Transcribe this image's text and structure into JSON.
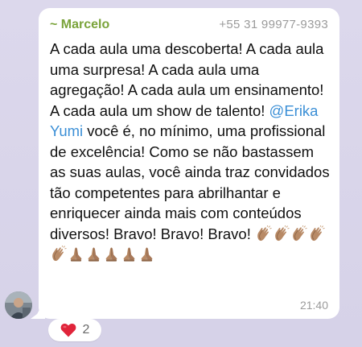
{
  "colors": {
    "chat_background": "#d8d4ea",
    "bubble": "#ffffff",
    "sender_name": "#7aa33a",
    "mention": "#3b8fd6",
    "meta_text": "#9b9b9b"
  },
  "message": {
    "sender_name": "~ Marcelo",
    "sender_phone": "+55 31 99977-9393",
    "text_before_mention": "A cada aula uma descoberta! A cada aula uma surpresa! A cada aula uma agregação! A cada aula um ensinamento! A cada aula um show de talento! ",
    "mention": "@Erika Yumi",
    "text_after_mention": " você é, no mínimo, uma profissional de excelência! Como se não bastassem as suas aulas, você ainda traz convidados tão competentes para abrilhantar e enriquecer ainda mais com conteúdos diversos! Bravo! Bravo! Bravo! ",
    "emojis": [
      "clapping-hands",
      "clapping-hands",
      "clapping-hands",
      "clapping-hands",
      "clapping-hands",
      "folded-hands",
      "folded-hands",
      "folded-hands",
      "folded-hands",
      "folded-hands"
    ],
    "time": "21:40"
  },
  "reaction": {
    "emoji": "red-heart",
    "count": "2"
  },
  "avatar": {
    "icon": "profile-photo"
  }
}
